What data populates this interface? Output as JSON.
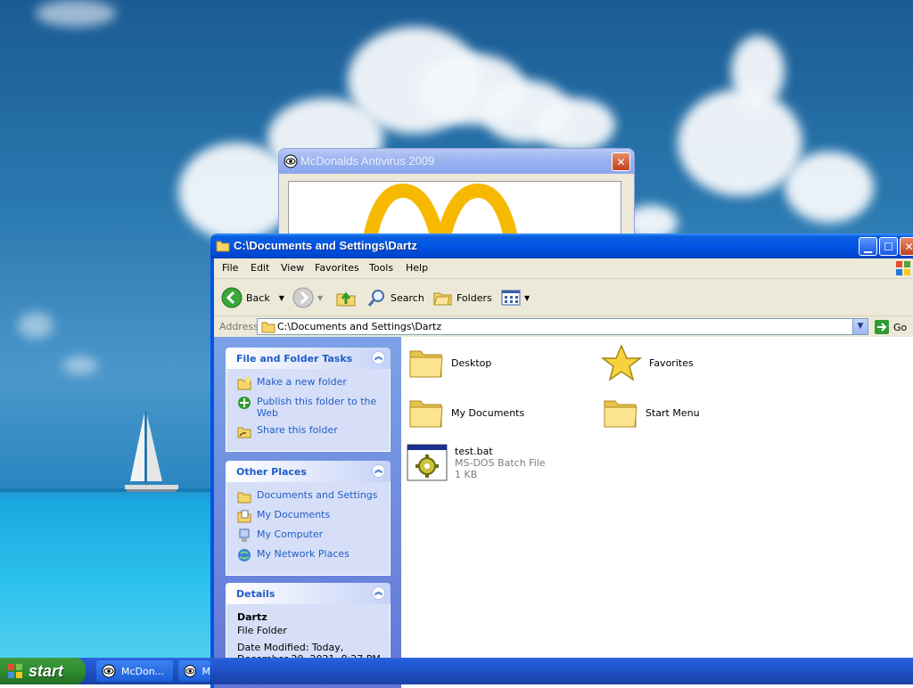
{
  "antivirus_window": {
    "title": "McDonalds Antivirus 2009"
  },
  "explorer": {
    "title": "C:\\Documents and Settings\\Dartz",
    "menu": [
      "File",
      "Edit",
      "View",
      "Favorites",
      "Tools",
      "Help"
    ],
    "toolbar": {
      "back": "Back",
      "search": "Search",
      "folders": "Folders"
    },
    "address": {
      "label": "Address",
      "value": "C:\\Documents and Settings\\Dartz",
      "go": "Go"
    },
    "file_tasks": {
      "title": "File and Folder Tasks",
      "items": [
        "Make a new folder",
        "Publish this folder to the Web",
        "Share this folder"
      ]
    },
    "other_places": {
      "title": "Other Places",
      "items": [
        "Documents and Settings",
        "My Documents",
        "My Computer",
        "My Network Places"
      ]
    },
    "details": {
      "title": "Details",
      "name": "Dartz",
      "type": "File Folder",
      "modified_label": "Date Modified: Today,",
      "modified_value": "December 20, 2021, 8:27 PM"
    },
    "items": [
      {
        "name": "Desktop",
        "icon": "folder-icon"
      },
      {
        "name": "Favorites",
        "icon": "star-icon"
      },
      {
        "name": "My Documents",
        "icon": "folder-icon"
      },
      {
        "name": "Start Menu",
        "icon": "folder-icon"
      }
    ],
    "batch_file": {
      "name": "test.bat",
      "type": "MS-DOS Batch File",
      "size": "1 KB"
    }
  },
  "taskbar": {
    "start": "start",
    "tasks": [
      "McDon...",
      "M"
    ]
  },
  "colors": {
    "titlebar_active": "#0055e5",
    "taskpane": "#6f8ee0",
    "link": "#215dc6",
    "start_green": "#2f8f2f"
  }
}
